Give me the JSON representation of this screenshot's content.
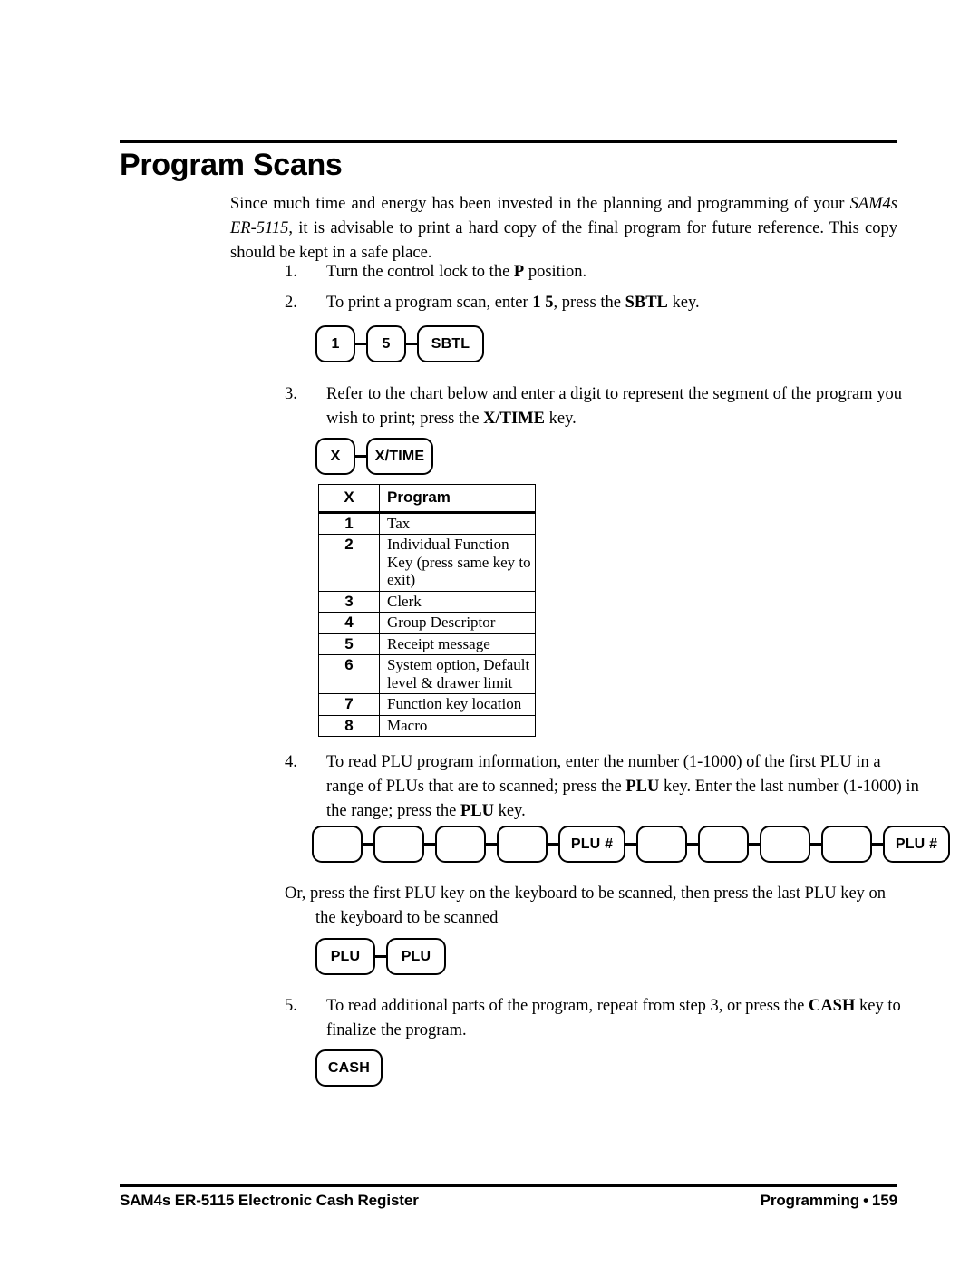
{
  "document": {
    "title": "Program Scans",
    "intro_part1": "Since much time and energy has been invested in the planning and programming of your ",
    "intro_italic1": "SAM4s ER-5115",
    "intro_part2": ", it is advisable to print a hard copy of the final program for future reference.  This copy should be kept in a safe place."
  },
  "steps": [
    {
      "number": "1.",
      "text_a": "Turn the control lock to the ",
      "bold_a": "P",
      "text_b": " position."
    },
    {
      "number": "2.",
      "text_a": "To print a program scan, enter ",
      "bold_a": "1 5",
      "text_b": ", press the ",
      "bold_b": "SBTL",
      "text_c": " key."
    },
    {
      "number": "3.",
      "text_a": "Refer to the chart below and enter a digit to represent the segment of the program you wish to print; press the ",
      "bold_a": "X/TIME",
      "text_b": " key."
    },
    {
      "number": "4.",
      "text_a": "To read PLU program information, enter the number (1-1000) of the first PLU in a range of PLUs that are to scanned; press the ",
      "bold_a": "PLU",
      "text_b": " key.  Enter the last number (1-1000) in the range; press the ",
      "bold_b": "PLU",
      "text_c": " key."
    },
    {
      "number": "5.",
      "text_a": "To read additional parts of the program, repeat from step 3, or press the ",
      "bold_a": "CASH",
      "text_b": " key to finalize the program."
    }
  ],
  "or_paragraph": {
    "line1": "Or, press the first PLU key on the keyboard to be scanned, then press the last PLU key on",
    "line2": "the keyboard to be scanned"
  },
  "key_sequences": {
    "sbtl": {
      "name": "sbtl-key-sequence",
      "keys": [
        "1",
        "5",
        "SBTL"
      ]
    },
    "xtime": {
      "name": "xtime-key-sequence",
      "keys": [
        "X",
        "X/TIME"
      ]
    },
    "plunum": {
      "name": "plu-number-key-sequence",
      "keys": [
        "",
        "",
        "",
        "",
        "PLU #",
        "",
        "",
        "",
        "",
        "PLU #"
      ]
    },
    "plu": {
      "name": "plu-key-sequence",
      "keys": [
        "PLU",
        "PLU"
      ]
    },
    "cash": {
      "name": "cash-key-sequence",
      "keys": [
        "CASH"
      ]
    }
  },
  "program_table": {
    "headers": [
      "X",
      "Program"
    ],
    "rows": [
      {
        "x": "1",
        "program": "Tax",
        "tall": false
      },
      {
        "x": "2",
        "program": "Individual Function Key (press same key to exit)",
        "tall": true
      },
      {
        "x": "3",
        "program": "Clerk",
        "tall": false
      },
      {
        "x": "4",
        "program": "Group Descriptor",
        "tall": false
      },
      {
        "x": "5",
        "program": "Receipt message",
        "tall": false
      },
      {
        "x": "6",
        "program": "System option, Default level & drawer limit",
        "tall": true
      },
      {
        "x": "7",
        "program": "Function key location",
        "tall": false
      },
      {
        "x": "8",
        "program": "Macro",
        "tall": false
      }
    ]
  },
  "footer": {
    "left": "SAM4s ER-5115 Electronic Cash Register",
    "section": "Programming",
    "bullet": "•",
    "page_number": "159"
  }
}
